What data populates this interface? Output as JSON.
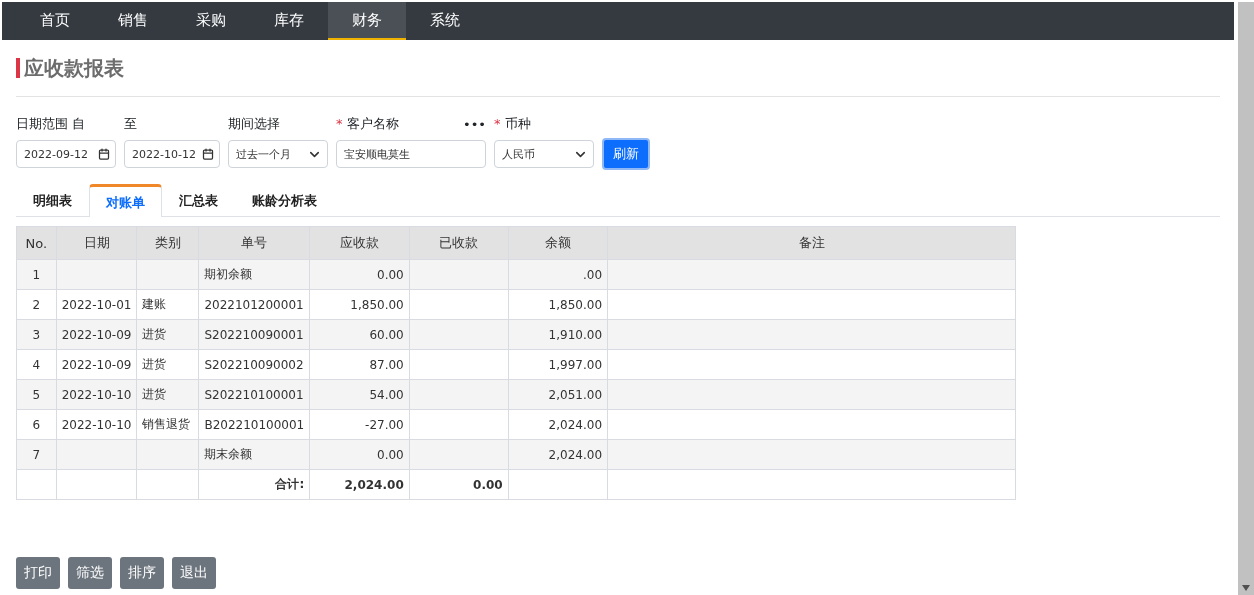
{
  "nav": [
    {
      "label": "首页",
      "selected": false
    },
    {
      "label": "销售",
      "selected": false
    },
    {
      "label": "采购",
      "selected": false
    },
    {
      "label": "库存",
      "selected": false
    },
    {
      "label": "财务",
      "selected": true
    },
    {
      "label": "系统",
      "selected": false
    }
  ],
  "page_title": "应收款报表",
  "filters": [
    {
      "kind": "date",
      "label": "日期范围 自",
      "value": "2022-09-12"
    },
    {
      "kind": "date",
      "label": "至",
      "value": "2022-10-12"
    },
    {
      "kind": "select",
      "label": "期间选择",
      "value": "过去一个月"
    },
    {
      "kind": "text",
      "label": "客户名称",
      "required_mark": "*",
      "value": "宝安顺电莫生",
      "more": "•••"
    },
    {
      "kind": "select",
      "label": "币种",
      "required_mark": "*",
      "value": "人民币"
    }
  ],
  "refresh_button": "刷新",
  "tabs": [
    {
      "label": "明细表",
      "selected": false
    },
    {
      "label": "对账单",
      "selected": true
    },
    {
      "label": "汇总表",
      "selected": false
    },
    {
      "label": "账龄分析表",
      "selected": false
    }
  ],
  "table": {
    "columns": [
      "No.",
      "日期",
      "类别",
      "单号",
      "应收款",
      "已收款",
      "余额",
      "备注"
    ],
    "rows": [
      {
        "kind": "data",
        "cells": [
          "1",
          "",
          "",
          "期初余额",
          "0.00",
          "",
          ".00",
          ""
        ]
      },
      {
        "kind": "data",
        "cells": [
          "2",
          "2022-10-01",
          "建账",
          "2022101200001",
          "1,850.00",
          "",
          "1,850.00",
          ""
        ]
      },
      {
        "kind": "data",
        "cells": [
          "3",
          "2022-10-09",
          "进货",
          "S202210090001",
          "60.00",
          "",
          "1,910.00",
          ""
        ]
      },
      {
        "kind": "data",
        "cells": [
          "4",
          "2022-10-09",
          "进货",
          "S202210090002",
          "87.00",
          "",
          "1,997.00",
          ""
        ]
      },
      {
        "kind": "data",
        "cells": [
          "5",
          "2022-10-10",
          "进货",
          "S202210100001",
          "54.00",
          "",
          "2,051.00",
          ""
        ]
      },
      {
        "kind": "data",
        "cells": [
          "6",
          "2022-10-10",
          "销售退货",
          "B202210100001",
          "-27.00",
          "",
          "2,024.00",
          ""
        ]
      },
      {
        "kind": "data",
        "cells": [
          "7",
          "",
          "",
          "期末余额",
          "0.00",
          "",
          "2,024.00",
          ""
        ]
      },
      {
        "kind": "total",
        "cells": [
          "",
          "",
          "",
          "合计:",
          "2,024.00",
          "0.00",
          "",
          ""
        ]
      }
    ]
  },
  "buttons": [
    "打印",
    "筛选",
    "排序",
    "退出"
  ]
}
